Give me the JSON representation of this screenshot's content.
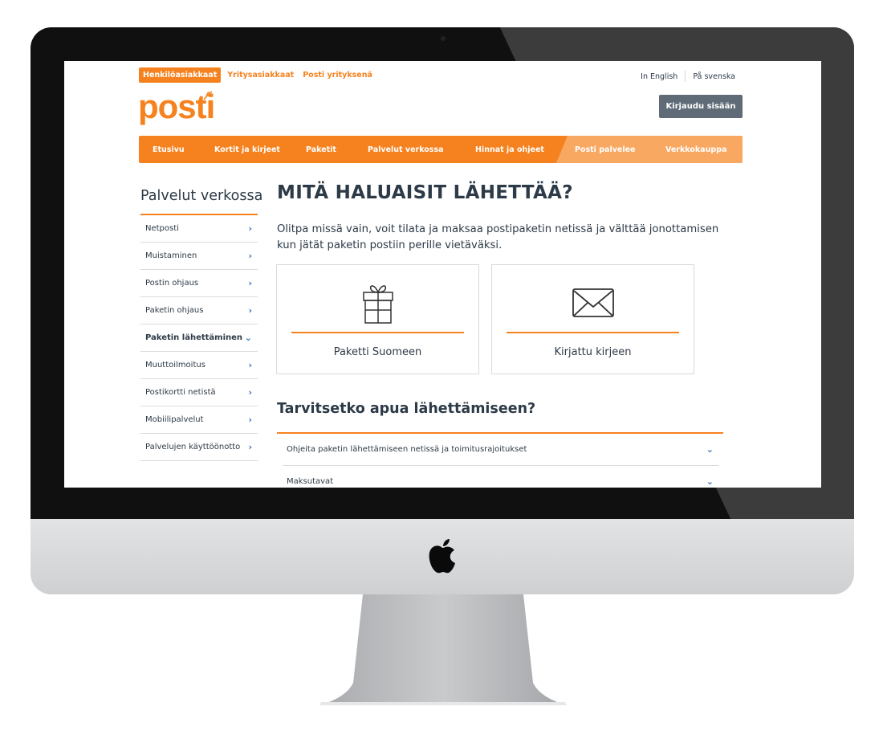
{
  "topbar": {
    "segments": [
      "Henkilöasiakkaat",
      "Yritysasiakkaat",
      "Posti yrityksenä"
    ],
    "languages": [
      "In English",
      "På svenska"
    ]
  },
  "logo_text": "posti",
  "login_label": "Kirjaudu sisään",
  "main_nav": [
    "Etusivu",
    "Kortit ja kirjeet",
    "Paketit",
    "Palvelut verkossa",
    "Hinnat ja ohjeet",
    "Posti palvelee",
    "Verkkokauppa"
  ],
  "sidebar": {
    "title": "Palvelut verkossa",
    "items": [
      {
        "label": "Netposti",
        "chevron": "›"
      },
      {
        "label": "Muistaminen",
        "chevron": "›"
      },
      {
        "label": "Postin ohjaus",
        "chevron": "›"
      },
      {
        "label": "Paketin ohjaus",
        "chevron": "›"
      },
      {
        "label": "Paketin lähettäminen",
        "chevron": "⌄"
      },
      {
        "label": "Muuttoilmoitus",
        "chevron": "›"
      },
      {
        "label": "Postikortti netistä",
        "chevron": "›"
      },
      {
        "label": "Mobiilipalvelut",
        "chevron": "›"
      },
      {
        "label": "Palvelujen käyttöönotto",
        "chevron": "›"
      }
    ]
  },
  "content": {
    "title": "MITÄ HALUAISIT LÄHETTÄÄ?",
    "intro": "Olitpa missä vain, voit tilata ja maksaa postipaketin netissä ja välttää jonottamisen kun jätät paketin postiin perille vietäväksi.",
    "cards": [
      {
        "label": "Paketti Suomeen",
        "icon": "gift-icon"
      },
      {
        "label": "Kirjattu kirjeen",
        "icon": "envelope-icon"
      }
    ],
    "help_title": "Tarvitsetko apua lähettämiseen?",
    "accordion": [
      {
        "label": "Ohjeita paketin lähettämiseen netissä ja toimitusrajoitukset",
        "chevron": "⌄"
      },
      {
        "label": "Maksutavat",
        "chevron": "⌄"
      }
    ]
  },
  "colors": {
    "brand_orange": "#f5821f",
    "light_orange": "#f9a862",
    "link_blue": "#2f6eb7",
    "text_dark": "#2d3a47",
    "button_gray": "#5f6b76"
  }
}
